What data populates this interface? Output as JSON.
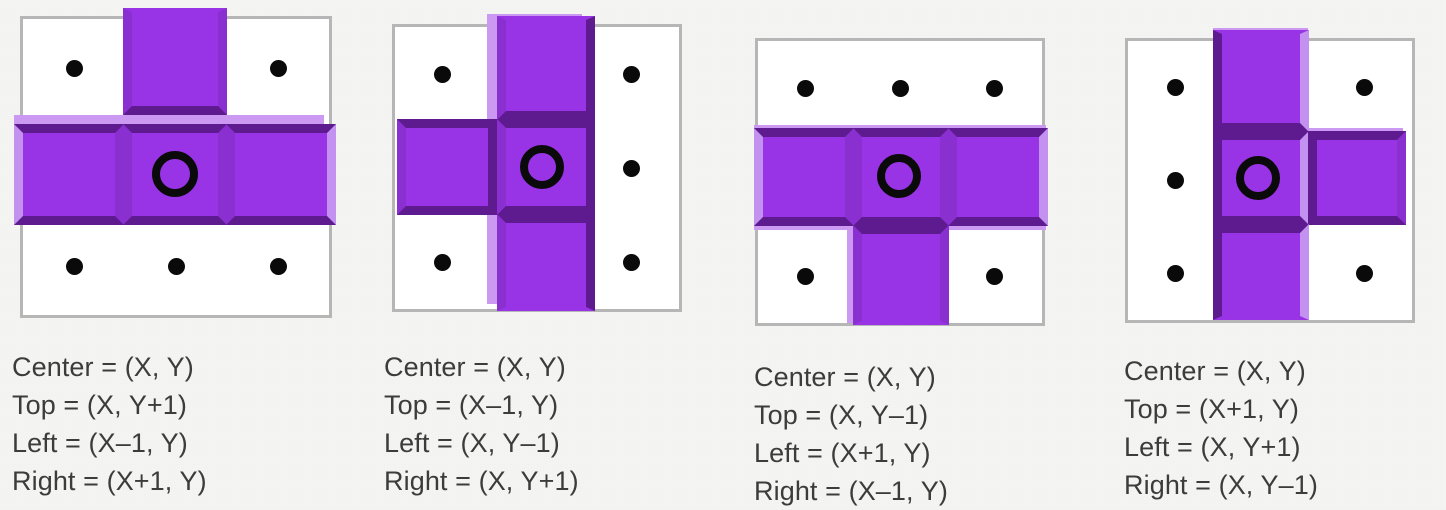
{
  "page": {
    "background_color": "#f4f4f2",
    "block_color": "#9933e6",
    "block_shadow_color": "#5e1b8f",
    "block_highlight_color": "#cc99f2",
    "frame_color": "#b6b6b6",
    "dot_color": "#0a0a0a",
    "text_color": "#3c3c3c"
  },
  "panels": [
    {
      "id": "panel-1",
      "name": "tromino-up",
      "shape_description": "T piece pointing up: center cell with left, right and top arms",
      "center_marker": "O",
      "captions": [
        "Center = (X, Y)",
        "Top = (X, Y+1)",
        "Left = (X–1, Y)",
        "Right = (X+1, Y)"
      ]
    },
    {
      "id": "panel-2",
      "name": "tromino-left",
      "shape_description": "Vertical bar with left arm: center cell with top, bottom and left arms",
      "center_marker": "O",
      "captions": [
        "Center = (X, Y)",
        "Top = (X–1, Y)",
        "Left = (X, Y–1)",
        "Right = (X, Y+1)"
      ]
    },
    {
      "id": "panel-3",
      "name": "tromino-down",
      "shape_description": "T piece pointing down: center cell with left, right and bottom arms",
      "center_marker": "O",
      "captions": [
        "Center = (X, Y)",
        "Top = (X, Y–1)",
        "Left = (X+1, Y)",
        "Right = (X–1, Y)"
      ]
    },
    {
      "id": "panel-4",
      "name": "tromino-right",
      "shape_description": "Vertical bar with right arm: center cell with top, bottom and right arms",
      "center_marker": "O",
      "captions": [
        "Center = (X, Y)",
        "Top = (X+1, Y)",
        "Left = (X, Y+1)",
        "Right = (X, Y–1)"
      ]
    }
  ]
}
